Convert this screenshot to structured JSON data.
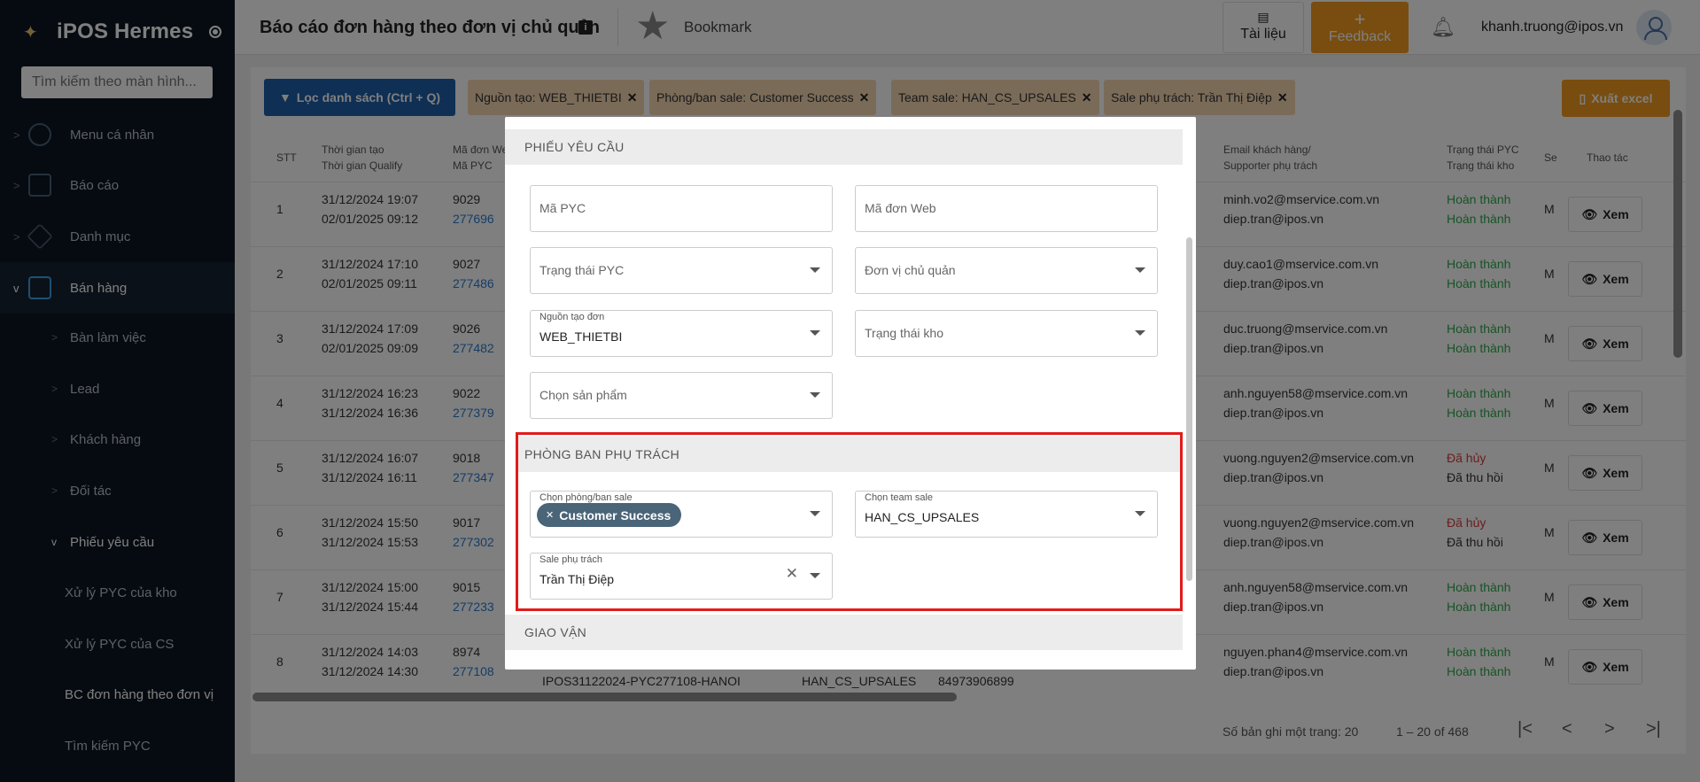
{
  "sidebar": {
    "brand": "iPOS Hermes",
    "search_placeholder": "Tìm kiếm theo màn hình...",
    "groups": [
      {
        "label": "Menu cá nhân",
        "icon": "gear-icon"
      },
      {
        "label": "Báo cáo",
        "icon": "chart-icon"
      },
      {
        "label": "Danh mục",
        "icon": "layers-icon"
      },
      {
        "label": "Bán hàng",
        "icon": "monitor-icon"
      }
    ],
    "sub_items": [
      "Bàn làm việc",
      "Lead",
      "Khách hàng",
      "Đối tác",
      "Phiếu yêu cầu"
    ],
    "leaf_items": [
      "Xử lý PYC của kho",
      "Xử lý PYC của CS",
      "BC đơn hàng theo đơn vị",
      "Tìm kiếm PYC"
    ]
  },
  "header": {
    "title": "Báo cáo đơn hàng theo đơn vị chủ quản",
    "info": "i",
    "bookmark": "Bookmark",
    "docs_label": "Tài liệu",
    "feedback_plus": "+",
    "feedback_label": "Feedback",
    "user_email": "khanh.truong@ipos.vn"
  },
  "toolbar": {
    "filter_label": "Lọc danh sách (Ctrl + Q)",
    "chips": [
      "Nguồn tạo: WEB_THIETBI",
      "Phòng/ban sale: Customer Success",
      "Team sale: HAN_CS_UPSALES",
      "Sale phụ trách: Trần Thị Điệp"
    ],
    "export_label": "Xuất excel"
  },
  "table": {
    "headers": {
      "stt": "STT",
      "time1": "Thời gian tạo",
      "time2": "Thời gian Qualify",
      "code1": "Mã đơn Web",
      "code2": "Mã PYC",
      "email1": "Email khách hàng/",
      "email2": "Supporter phụ trách",
      "status1": "Trạng thái PYC",
      "status2": "Trạng thái kho",
      "se": "Se",
      "action": "Thao tác"
    },
    "rows": [
      {
        "stt": "1",
        "t1": "31/12/2024 19:07",
        "t2": "02/01/2025 09:12",
        "web": "9029",
        "pyc": "277696",
        "e1": "minh.vo2@mservice.com.vn",
        "e2": "diep.tran@ipos.vn",
        "s1": "Hoàn thành",
        "s2": "Hoàn thành",
        "s1c": "green",
        "s2c": "green",
        "se": "M"
      },
      {
        "stt": "2",
        "t1": "31/12/2024 17:10",
        "t2": "02/01/2025 09:11",
        "web": "9027",
        "pyc": "277486",
        "e1": "duy.cao1@mservice.com.vn",
        "e2": "diep.tran@ipos.vn",
        "s1": "Hoàn thành",
        "s2": "Hoàn thành",
        "s1c": "green",
        "s2c": "green",
        "se": "M"
      },
      {
        "stt": "3",
        "t1": "31/12/2024 17:09",
        "t2": "02/01/2025 09:09",
        "web": "9026",
        "pyc": "277482",
        "e1": "duc.truong@mservice.com.vn",
        "e2": "diep.tran@ipos.vn",
        "s1": "Hoàn thành",
        "s2": "Hoàn thành",
        "s1c": "green",
        "s2c": "green",
        "se": "M"
      },
      {
        "stt": "4",
        "t1": "31/12/2024 16:23",
        "t2": "31/12/2024 16:36",
        "web": "9022",
        "pyc": "277379",
        "e1": "anh.nguyen58@mservice.com.vn",
        "e2": "diep.tran@ipos.vn",
        "s1": "Hoàn thành",
        "s2": "Hoàn thành",
        "s1c": "green",
        "s2c": "green",
        "se": "M"
      },
      {
        "stt": "5",
        "t1": "31/12/2024 16:07",
        "t2": "31/12/2024 16:11",
        "web": "9018",
        "pyc": "277347",
        "e1": "vuong.nguyen2@mservice.com.vn",
        "e2": "diep.tran@ipos.vn",
        "s1": "Đã hủy",
        "s2": "Đã thu hồi",
        "s1c": "red",
        "s2c": "",
        "se": "M"
      },
      {
        "stt": "6",
        "t1": "31/12/2024 15:50",
        "t2": "31/12/2024 15:53",
        "web": "9017",
        "pyc": "277302",
        "e1": "vuong.nguyen2@mservice.com.vn",
        "e2": "diep.tran@ipos.vn",
        "s1": "Đã hủy",
        "s2": "Đã thu hồi",
        "s1c": "red",
        "s2c": "",
        "se": "M"
      },
      {
        "stt": "7",
        "t1": "31/12/2024 15:00",
        "t2": "31/12/2024 15:44",
        "web": "9015",
        "pyc": "277233",
        "e1": "anh.nguyen58@mservice.com.vn",
        "e2": "diep.tran@ipos.vn",
        "s1": "Hoàn thành",
        "s2": "Hoàn thành",
        "s1c": "green",
        "s2c": "green",
        "se": "M"
      },
      {
        "stt": "8",
        "t1": "31/12/2024 14:03",
        "t2": "31/12/2024 14:30",
        "web": "8974",
        "pyc": "277108",
        "e1": "nguyen.phan4@mservice.com.vn",
        "e2": "diep.tran@ipos.vn",
        "s1": "Hoàn thành",
        "s2": "Hoàn thành",
        "s1c": "green",
        "s2c": "green",
        "se": "M"
      }
    ],
    "row8_extra": {
      "code": "IPOS31122024-PYC277108-HANOI",
      "team": "HAN_CS_UPSALES",
      "phone": "84973906899"
    },
    "view_label": "Xem"
  },
  "pagination": {
    "per_page_label": "Số bản ghi một trang: 20",
    "range_label": "1 – 20 of 468"
  },
  "modal": {
    "section1": "PHIẾU YÊU CẦU",
    "ma_pyc": "Mã PYC",
    "ma_don_web": "Mã đơn Web",
    "trang_thai_pyc": "Trạng thái PYC",
    "don_vi_chu_quan": "Đơn vị chủ quản",
    "nguon_tao_label": "Nguồn tạo đơn",
    "nguon_tao_value": "WEB_THIETBI",
    "trang_thai_kho": "Trạng thái kho",
    "chon_san_pham": "Chọn sản phẩm",
    "section2": "PHÒNG BAN PHỤ TRÁCH",
    "phong_ban_label": "Chọn phòng/ban sale",
    "phong_ban_tag": "Customer Success",
    "team_label": "Chọn team sale",
    "team_value": "HAN_CS_UPSALES",
    "sale_label": "Sale phụ trách",
    "sale_value": "Trần Thị Điệp",
    "section3": "GIAO VẬN"
  }
}
